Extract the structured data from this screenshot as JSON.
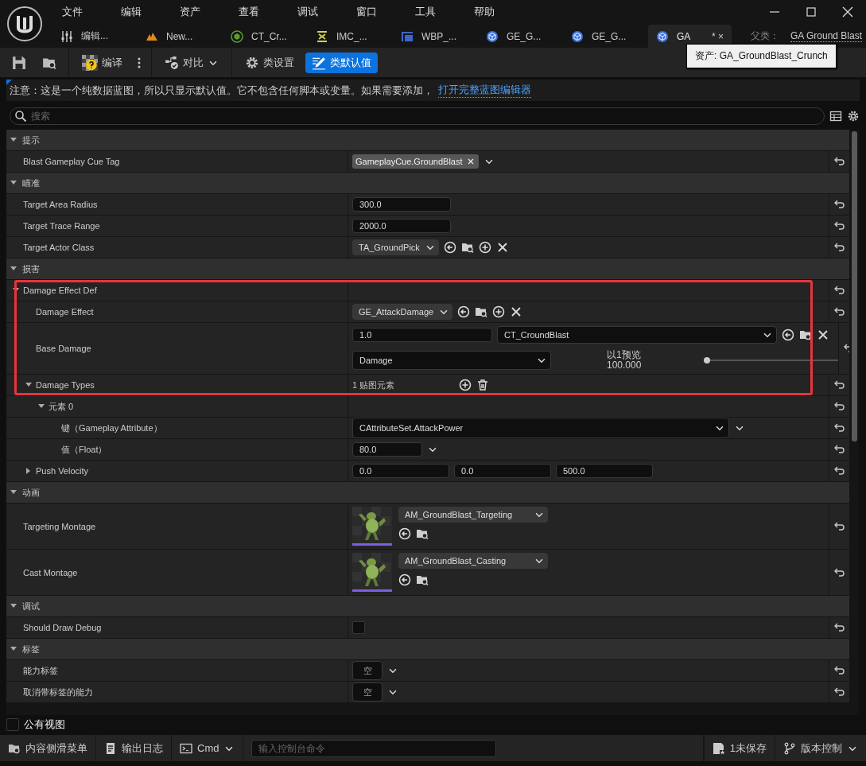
{
  "window": {
    "menu": [
      "文件",
      "编辑",
      "资产",
      "查看",
      "调试",
      "窗口",
      "工具",
      "帮助"
    ],
    "tabs": [
      {
        "label": "编辑...",
        "selected": false
      },
      {
        "label": "New...",
        "selected": false
      },
      {
        "label": "CT_Cr...",
        "selected": false
      },
      {
        "label": "IMC_...",
        "selected": false
      },
      {
        "label": "WBP_...",
        "selected": false
      },
      {
        "label": "GE_G...",
        "selected": false
      },
      {
        "label": "GE_G...",
        "selected": false
      },
      {
        "label": "GA",
        "selected": true,
        "dirty": "*",
        "close": "×"
      }
    ],
    "parent": {
      "label": "父类：",
      "value": "GA Ground Blast"
    },
    "tooltip": "资产: GA_GroundBlast_Crunch"
  },
  "toolbar": [
    [
      {
        "kind": "save"
      },
      {
        "kind": "browse"
      }
    ],
    [
      {
        "kind": "compile",
        "label": "编译"
      },
      {
        "kind": "more"
      }
    ],
    [
      {
        "kind": "diff",
        "label": "对比"
      }
    ],
    [
      {
        "kind": "settings",
        "label": "类设置",
        "selected": false
      },
      {
        "kind": "defaults",
        "label": "类默认值",
        "selected": true
      }
    ]
  ],
  "notice": {
    "text": "注意：这是一个纯数据蓝图，所以只显示默认值。它不包含任何脚本或变量。如果需要添加，",
    "link": "打开完整蓝图编辑器"
  },
  "search": {
    "placeholder": "搜索"
  },
  "sections": [
    {
      "title": "提示",
      "expanded": true,
      "rows": [
        {
          "kind": "tag",
          "label": "Blast Gameplay Cue Tag",
          "value": "GameplayCue.GroundBlast"
        }
      ]
    },
    {
      "title": "瞄准",
      "expanded": true,
      "rows": [
        {
          "kind": "number",
          "label": "Target Area Radius",
          "value": "300.0"
        },
        {
          "kind": "number",
          "label": "Target Trace Range",
          "value": "2000.0"
        },
        {
          "kind": "asset",
          "label": "Target Actor Class",
          "value": "TA_GroundPick"
        }
      ]
    },
    {
      "title": "损害",
      "expanded": true,
      "rows": [
        {
          "kind": "group",
          "label": "Damage Effect Def",
          "expanded": true,
          "highlighted": true,
          "children": [
            {
              "kind": "asset",
              "label": "Damage Effect",
              "value": "GE_AttackDamage",
              "highlighted": true
            },
            {
              "kind": "scalable",
              "label": "Base Damage",
              "value": "1.0",
              "curve_table": "CT_CroundBlast",
              "row_name": "Damage",
              "preview_label": "以1预览",
              "preview_value": "100.000",
              "level": 0,
              "highlighted": true
            },
            {
              "kind": "array",
              "label": "Damage Types",
              "expanded": true,
              "count": "1 贴图元素",
              "highlighted": true,
              "children": [
                {
                  "kind": "group",
                  "label": "元素 0",
                  "expanded": true,
                  "children": [
                    {
                      "kind": "attribute",
                      "label": "键（Gameplay Attribute）",
                      "value": "CAttributeSet.AttackPower"
                    },
                    {
                      "kind": "float",
                      "label": "值（Float）",
                      "value": "80.0"
                    }
                  ]
                }
              ]
            },
            {
              "kind": "vector",
              "label": "Push Velocity",
              "expanded": false,
              "values": [
                "0.0",
                "0.0",
                "500.0"
              ]
            }
          ]
        }
      ]
    },
    {
      "title": "动画",
      "expanded": true,
      "rows": [
        {
          "kind": "montage",
          "label": "Targeting Montage",
          "value": "AM_GroundBlast_Targeting"
        },
        {
          "kind": "montage",
          "label": "Cast Montage",
          "value": "AM_GroundBlast_Casting"
        }
      ]
    },
    {
      "title": "调试",
      "expanded": true,
      "rows": [
        {
          "kind": "checkbox",
          "label": "Should Draw Debug",
          "checked": false
        }
      ]
    },
    {
      "title": "标签",
      "expanded": true,
      "rows": [
        {
          "kind": "tags",
          "label": "能力标签",
          "value": "空"
        },
        {
          "kind": "tags",
          "label": "取消带标签的能力",
          "value": "空"
        }
      ]
    }
  ],
  "public_view": {
    "label": "公有视图",
    "checked": false
  },
  "status_bar": {
    "left": [
      {
        "label": "内容侧滑菜单"
      },
      {
        "label": "输出日志"
      },
      {
        "label": "Cmd",
        "dropdown": true
      }
    ],
    "console": {
      "placeholder": "输入控制台命令"
    },
    "right": [
      {
        "label": "1未保存"
      },
      {
        "label": "版本控制",
        "dropdown": true
      }
    ]
  }
}
